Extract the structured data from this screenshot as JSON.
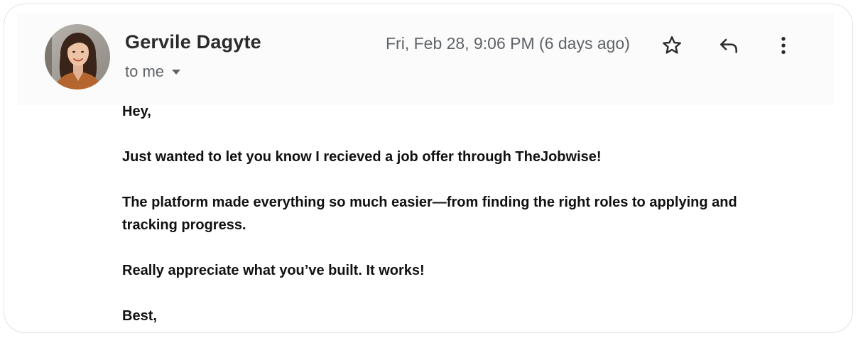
{
  "email": {
    "sender_name": "Gervile Dagyte",
    "recipient": "to me",
    "timestamp": "Fri, Feb 28, 9:06 PM (6 days ago)",
    "body": {
      "greeting": "Hey,",
      "paragraph_1": "Just wanted to let you know I recieved a job offer through TheJobwise!",
      "paragraph_2": "The platform made everything so much easier—from finding the right roles to applying and tracking progress.",
      "paragraph_3": "Really appreciate what you’ve built. It works!",
      "signoff": "Best,"
    }
  },
  "icons": {
    "star": "star-icon",
    "reply": "reply-icon",
    "more": "more-vertical-icon",
    "recipient_dropdown": "caret-down-icon"
  },
  "colors": {
    "sender_text": "#2b2b2b",
    "meta_text": "#5f6368",
    "body_text": "#111111",
    "card_border": "#e3e3e3"
  }
}
